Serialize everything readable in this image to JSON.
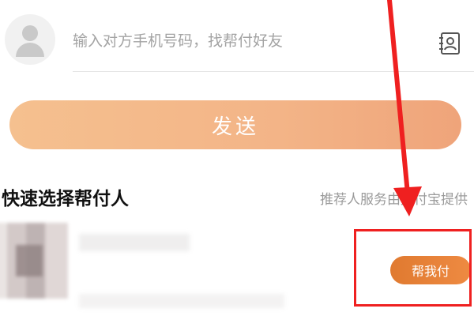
{
  "contact": {
    "avatar_icon": "user-avatar-icon",
    "input_value": "",
    "input_placeholder": "输入对方手机号码，找帮付好友",
    "contact_book_icon": "contact-book-icon"
  },
  "send_button": {
    "label": "发送"
  },
  "quick_select": {
    "title": "快速选择帮付人",
    "recommend_note": "推荐人服务由支付宝提供"
  },
  "contact_item": {
    "action_label": "帮我付"
  },
  "annotation": {
    "color": "#ef2020"
  },
  "colors": {
    "send_button": "#f3b487",
    "action_button": "#e8813a",
    "annotation": "#ef2020"
  }
}
